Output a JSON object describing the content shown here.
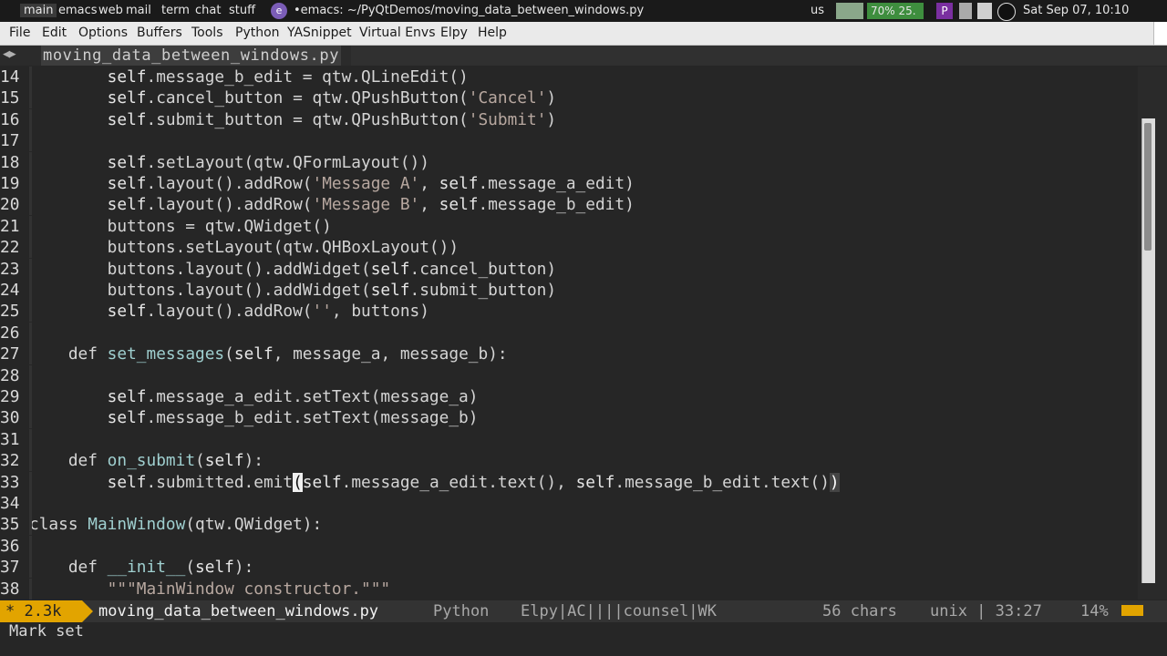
{
  "topbar": {
    "workspaces": [
      "main",
      "emacs",
      "web",
      "mail",
      "term",
      "chat",
      "stuff"
    ],
    "window_title": "•emacs: ~/PyQtDemos/moving_data_between_windows.py",
    "keyboard": "us",
    "battery": "70% 25.",
    "datetime": "Sat Sep 07, 10:10"
  },
  "menubar": {
    "items": [
      "File",
      "Edit",
      "Options",
      "Buffers",
      "Tools",
      "Python",
      "YASnippet",
      "Virtual Envs",
      "Elpy",
      "Help"
    ]
  },
  "tabline": {
    "file": "moving_data_between_windows.py"
  },
  "code": {
    "lines": [
      {
        "n": "14",
        "parts": [
          [
            "",
            "        "
          ],
          [
            "self",
            "self"
          ],
          [
            "",
            ".message_b_edit = qtw.QLineEdit()"
          ]
        ]
      },
      {
        "n": "15",
        "parts": [
          [
            "",
            "        "
          ],
          [
            "self",
            "self"
          ],
          [
            "",
            ".cancel_button = qtw.QPushButton("
          ],
          [
            "str",
            "'Cancel'"
          ],
          [
            "",
            ")"
          ]
        ]
      },
      {
        "n": "16",
        "parts": [
          [
            "",
            "        "
          ],
          [
            "self",
            "self"
          ],
          [
            "",
            ".submit_button = qtw.QPushButton("
          ],
          [
            "str",
            "'Submit'"
          ],
          [
            "",
            ")"
          ]
        ]
      },
      {
        "n": "17",
        "parts": []
      },
      {
        "n": "18",
        "parts": [
          [
            "",
            "        "
          ],
          [
            "self",
            "self"
          ],
          [
            "",
            ".setLayout(qtw.QFormLayout())"
          ]
        ]
      },
      {
        "n": "19",
        "parts": [
          [
            "",
            "        "
          ],
          [
            "self",
            "self"
          ],
          [
            "",
            ".layout().addRow("
          ],
          [
            "str",
            "'Message A'"
          ],
          [
            "",
            ", "
          ],
          [
            "self",
            "self"
          ],
          [
            "",
            ".message_a_edit)"
          ]
        ]
      },
      {
        "n": "20",
        "parts": [
          [
            "",
            "        "
          ],
          [
            "self",
            "self"
          ],
          [
            "",
            ".layout().addRow("
          ],
          [
            "str",
            "'Message B'"
          ],
          [
            "",
            ", "
          ],
          [
            "self",
            "self"
          ],
          [
            "",
            ".message_b_edit)"
          ]
        ]
      },
      {
        "n": "21",
        "parts": [
          [
            "",
            "        buttons = qtw.QWidget()"
          ]
        ]
      },
      {
        "n": "22",
        "parts": [
          [
            "",
            "        buttons.setLayout(qtw.QHBoxLayout())"
          ]
        ]
      },
      {
        "n": "23",
        "parts": [
          [
            "",
            "        buttons.layout().addWidget("
          ],
          [
            "self",
            "self"
          ],
          [
            "",
            ".cancel_button)"
          ]
        ]
      },
      {
        "n": "24",
        "parts": [
          [
            "",
            "        buttons.layout().addWidget("
          ],
          [
            "self",
            "self"
          ],
          [
            "",
            ".submit_button)"
          ]
        ]
      },
      {
        "n": "25",
        "parts": [
          [
            "",
            "        "
          ],
          [
            "self",
            "self"
          ],
          [
            "",
            ".layout().addRow("
          ],
          [
            "str",
            "''"
          ],
          [
            "",
            ", buttons)"
          ]
        ]
      },
      {
        "n": "26",
        "parts": []
      },
      {
        "n": "27",
        "parts": [
          [
            "",
            "    "
          ],
          [
            "kw",
            "def"
          ],
          [
            "",
            " "
          ],
          [
            "fn",
            "set_messages"
          ],
          [
            "",
            "("
          ],
          [
            "self",
            "self"
          ],
          [
            "",
            ", message_a, message_b):"
          ]
        ]
      },
      {
        "n": "28",
        "parts": []
      },
      {
        "n": "29",
        "parts": [
          [
            "",
            "        "
          ],
          [
            "self",
            "self"
          ],
          [
            "",
            ".message_a_edit.setText(message_a)"
          ]
        ]
      },
      {
        "n": "30",
        "parts": [
          [
            "",
            "        "
          ],
          [
            "self",
            "self"
          ],
          [
            "",
            ".message_b_edit.setText(message_b)"
          ]
        ]
      },
      {
        "n": "31",
        "parts": []
      },
      {
        "n": "32",
        "parts": [
          [
            "",
            "    "
          ],
          [
            "kw",
            "def"
          ],
          [
            "",
            " "
          ],
          [
            "fn",
            "on_submit"
          ],
          [
            "",
            "("
          ],
          [
            "self",
            "self"
          ],
          [
            "",
            "):"
          ]
        ]
      },
      {
        "n": "33",
        "parts": [
          [
            "",
            "        "
          ],
          [
            "self",
            "self"
          ],
          [
            "",
            ".submitted.emit"
          ],
          [
            "cursor",
            "("
          ],
          [
            "self",
            "self"
          ],
          [
            "",
            ".message_a_edit.text(), "
          ],
          [
            "self",
            "self"
          ],
          [
            "",
            ".message_b_edit.text()"
          ],
          [
            "paren-hl",
            ")"
          ]
        ]
      },
      {
        "n": "34",
        "parts": []
      },
      {
        "n": "35",
        "parts": [
          [
            "kw",
            "class"
          ],
          [
            "",
            " "
          ],
          [
            "fn",
            "MainWindow"
          ],
          [
            "",
            "(qtw.QWidget):"
          ]
        ]
      },
      {
        "n": "36",
        "parts": []
      },
      {
        "n": "37",
        "parts": [
          [
            "",
            "    "
          ],
          [
            "kw",
            "def"
          ],
          [
            "",
            " "
          ],
          [
            "fn",
            "__init__"
          ],
          [
            "",
            "("
          ],
          [
            "self",
            "self"
          ],
          [
            "",
            "):"
          ]
        ]
      },
      {
        "n": "38",
        "parts": [
          [
            "",
            "        "
          ],
          [
            "str",
            "\"\"\"MainWindow constructor.\"\"\""
          ]
        ]
      }
    ]
  },
  "modeline": {
    "status": "* 2.3k",
    "file": "moving_data_between_windows.py",
    "mode": "Python",
    "minor": "Elpy|AC||||counsel|WK",
    "chars": "56 chars",
    "eol": "unix | 33:27",
    "pos": "",
    "pct": "14%"
  },
  "echo": {
    "message": "Mark set"
  }
}
